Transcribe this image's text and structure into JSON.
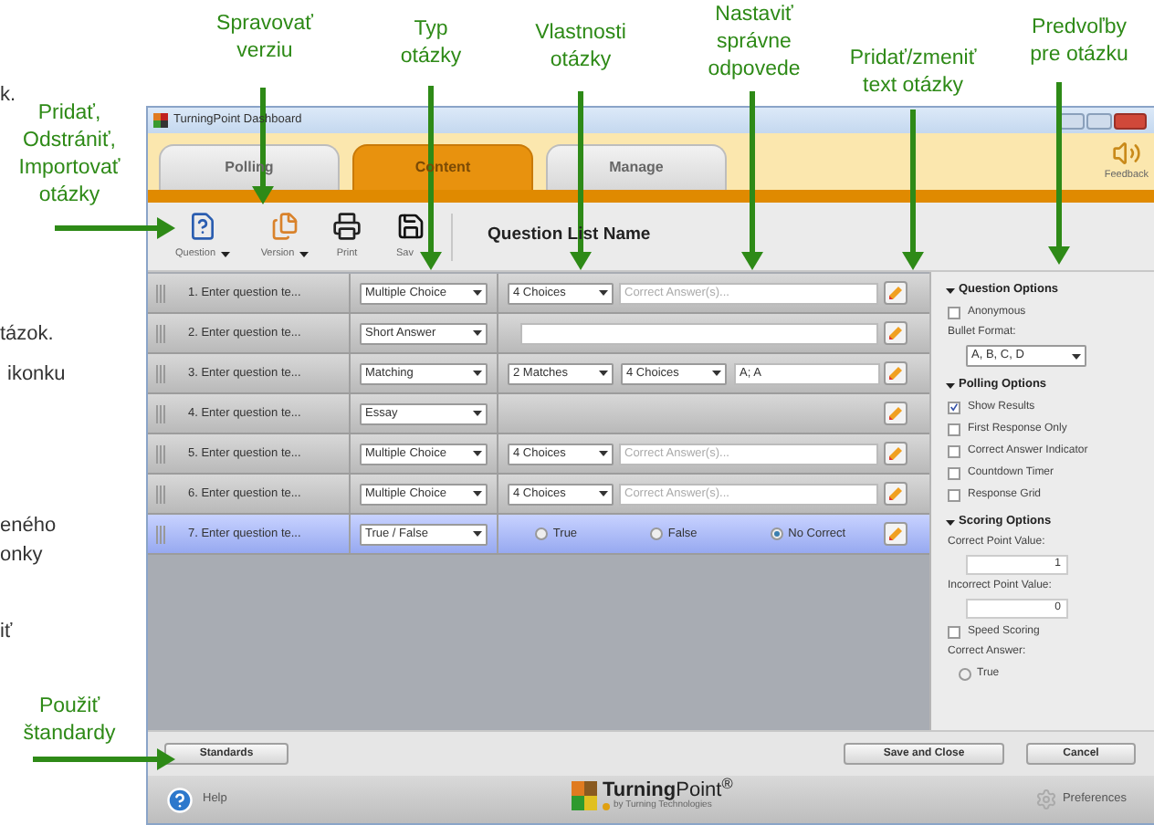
{
  "background_text": [
    "k.",
    "tázok.",
    "ikonku",
    "eného",
    "onky",
    "iť"
  ],
  "annotations": [
    {
      "text": "Spravovať\nverziu"
    },
    {
      "text": "Typ\notázky"
    },
    {
      "text": "Vlastnosti\notázky"
    },
    {
      "text": "Nastaviť\nsprávne\nodpovede"
    },
    {
      "text": "Pridať/zmeniť\ntext otázky"
    },
    {
      "text": "Predvoľby\npre otázku"
    },
    {
      "text": "Pridať,\nOdstrániť,\nImportovať\notázky"
    },
    {
      "text": "Použiť\nštandardy"
    }
  ],
  "window": {
    "title": "TurningPoint Dashboard"
  },
  "tabs": [
    {
      "label": "Polling",
      "selected": false
    },
    {
      "label": "Content",
      "selected": true
    },
    {
      "label": "Manage",
      "selected": false
    }
  ],
  "feedback": "Feedback",
  "toolbar": [
    {
      "label": "Question",
      "kind": "question",
      "menu": true
    },
    {
      "label": "Version",
      "kind": "version",
      "menu": true
    },
    {
      "label": "Print",
      "kind": "print",
      "menu": false
    },
    {
      "label": "Sav",
      "kind": "save",
      "menu": false
    }
  ],
  "list_name": "Question List Name",
  "questions": [
    {
      "label": "1. Enter question te...",
      "type": "Multiple Choice",
      "kind": "choices",
      "choices": "4 Choices",
      "placeholder": "Correct Answer(s)...",
      "selected": false
    },
    {
      "label": "2. Enter question te...",
      "type": "Short Answer",
      "kind": "short",
      "selected": false
    },
    {
      "label": "3. Enter question te...",
      "type": "Matching",
      "kind": "matching",
      "matches": "2 Matches",
      "choices": "4 Choices",
      "value": "A; A",
      "selected": false
    },
    {
      "label": "4. Enter question te...",
      "type": "Essay",
      "kind": "essay",
      "selected": false
    },
    {
      "label": "5. Enter question te...",
      "type": "Multiple Choice",
      "kind": "choices",
      "choices": "4 Choices",
      "placeholder": "Correct Answer(s)...",
      "selected": false
    },
    {
      "label": "6. Enter question te...",
      "type": "Multiple Choice",
      "kind": "choices",
      "choices": "4 Choices",
      "placeholder": "Correct Answer(s)...",
      "selected": false
    },
    {
      "label": "7. Enter question te...",
      "type": "True / False",
      "kind": "truefalse",
      "options": [
        {
          "label": "True",
          "selected": false
        },
        {
          "label": "False",
          "selected": false
        },
        {
          "label": "No Correct",
          "selected": true
        }
      ],
      "selected": true
    }
  ],
  "question_panel": {
    "sections": [
      {
        "title": "Question Options",
        "expanded": true,
        "items": [
          {
            "kind": "checkbox",
            "label": "Anonymous",
            "checked": false
          },
          {
            "kind": "label",
            "text": "Bullet Format:"
          },
          {
            "kind": "select",
            "value": "A, B, C, D"
          }
        ]
      },
      {
        "title": "Polling Options",
        "expanded": true,
        "items": [
          {
            "kind": "checkbox",
            "label": "Show Results",
            "checked": true
          },
          {
            "kind": "checkbox",
            "label": "First Response Only",
            "checked": false
          },
          {
            "kind": "checkbox",
            "label": "Correct Answer Indicator",
            "checked": false
          },
          {
            "kind": "checkbox",
            "label": "Countdown Timer",
            "checked": false
          },
          {
            "kind": "checkbox",
            "label": "Response Grid",
            "checked": false
          }
        ]
      },
      {
        "title": "Scoring Options",
        "expanded": true,
        "items": [
          {
            "kind": "label",
            "text": "Correct Point Value:"
          },
          {
            "kind": "number",
            "value": "1"
          },
          {
            "kind": "label",
            "text": "Incorrect Point Value:"
          },
          {
            "kind": "number",
            "value": "0"
          },
          {
            "kind": "checkbox",
            "label": "Speed Scoring",
            "checked": false
          },
          {
            "kind": "label",
            "text": "Correct Answer:"
          },
          {
            "kind": "radio",
            "label": "True",
            "selected": false
          }
        ]
      }
    ]
  },
  "buttons": {
    "standards": "Standards",
    "save": "Save and Close",
    "cancel": "Cancel"
  },
  "footer": {
    "help": "Help",
    "brand": "**Turning**Point$^{®}$",
    "brand_by": "by Turning Technologies",
    "preferences": "Preferences"
  }
}
